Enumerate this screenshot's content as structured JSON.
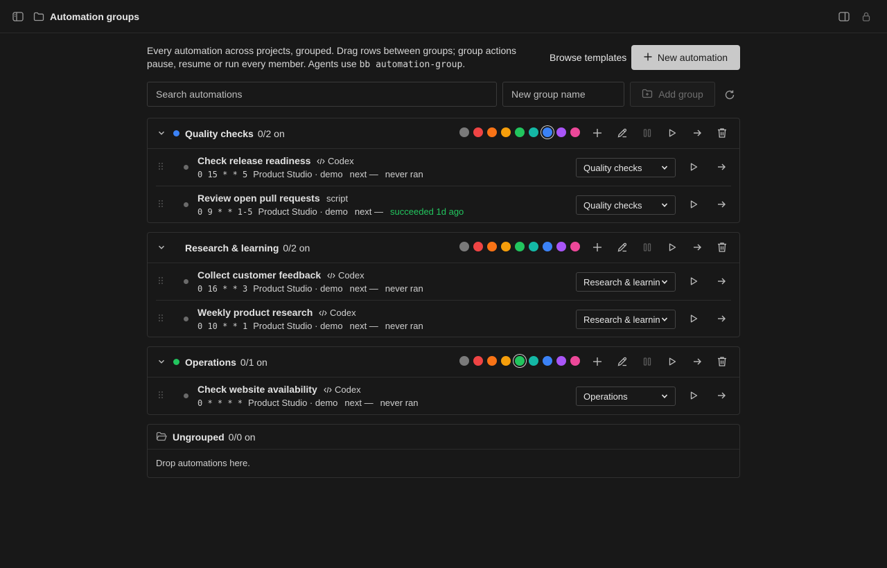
{
  "topbar": {
    "title": "Automation groups"
  },
  "intro": {
    "text": "Every automation across projects, grouped. Drag rows between groups; group actions pause, resume or run every member. Agents use ",
    "command": "bb automation-group",
    "suffix": "."
  },
  "toolbar": {
    "browse_label": "Browse templates",
    "new_label": "New automation",
    "search_placeholder": "Search automations",
    "group_name_placeholder": "New group name",
    "add_group_label": "Add group"
  },
  "swatch_colors": [
    "#7a7a7a",
    "#ef4444",
    "#f97316",
    "#f59e0b",
    "#22c55e",
    "#14b8a6",
    "#3b82f6",
    "#a855f7",
    "#ec4899"
  ],
  "groups": [
    {
      "name": "Quality checks",
      "count": "0/2 on",
      "color": "#3b82f6",
      "selected_swatch": 6,
      "rows": [
        {
          "name": "Check release readiness",
          "agent": "Codex",
          "agent_icon": "code-icon",
          "cron": "0 15 * * 5",
          "project": "Product Studio · demo",
          "next": "next —",
          "status": "never ran",
          "status_ok": false,
          "group": "Quality checks"
        },
        {
          "name": "Review open pull requests",
          "agent": "script",
          "agent_icon": "",
          "cron": "0 9 * * 1-5",
          "project": "Product Studio · demo",
          "next": "next —",
          "status": "succeeded 1d ago",
          "status_ok": true,
          "group": "Quality checks"
        }
      ]
    },
    {
      "name": "Research & learning",
      "count": "0/2 on",
      "color": "",
      "selected_swatch": -1,
      "rows": [
        {
          "name": "Collect customer feedback",
          "agent": "Codex",
          "agent_icon": "code-icon",
          "cron": "0 16 * * 3",
          "project": "Product Studio · demo",
          "next": "next —",
          "status": "never ran",
          "status_ok": false,
          "group": "Research & learnin"
        },
        {
          "name": "Weekly product research",
          "agent": "Codex",
          "agent_icon": "code-icon",
          "cron": "0 10 * * 1",
          "project": "Product Studio · demo",
          "next": "next —",
          "status": "never ran",
          "status_ok": false,
          "group": "Research & learnin"
        }
      ]
    },
    {
      "name": "Operations",
      "count": "0/1 on",
      "color": "#22c55e",
      "selected_swatch": 4,
      "rows": [
        {
          "name": "Check website availability",
          "agent": "Codex",
          "agent_icon": "code-icon",
          "cron": "0 * * * *",
          "project": "Product Studio · demo",
          "next": "next —",
          "status": "never ran",
          "status_ok": false,
          "group": "Operations"
        }
      ]
    }
  ],
  "ungrouped": {
    "name": "Ungrouped",
    "count": "0/0 on",
    "empty_text": "Drop automations here."
  }
}
